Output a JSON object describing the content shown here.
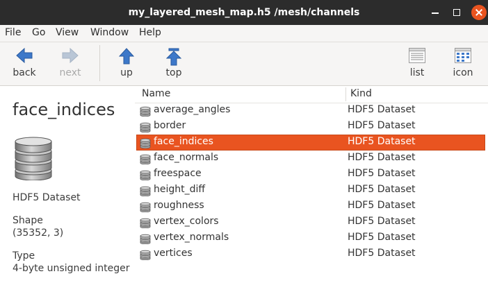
{
  "window": {
    "title": "my_layered_mesh_map.h5 /mesh/channels"
  },
  "menu": {
    "items": [
      "File",
      "Go",
      "View",
      "Window",
      "Help"
    ]
  },
  "toolbar": {
    "back_label": "back",
    "next_label": "next",
    "up_label": "up",
    "top_label": "top",
    "list_label": "list",
    "icon_label": "icon"
  },
  "info": {
    "name": "face_indices",
    "kind": "HDF5 Dataset",
    "shape_label": "Shape",
    "shape_value": "(35352, 3)",
    "type_label": "Type",
    "type_value": "4-byte unsigned integer"
  },
  "list": {
    "columns": {
      "name": "Name",
      "kind": "Kind"
    },
    "rows": [
      {
        "name": "average_angles",
        "kind": "HDF5 Dataset",
        "selected": false
      },
      {
        "name": "border",
        "kind": "HDF5 Dataset",
        "selected": false
      },
      {
        "name": "face_indices",
        "kind": "HDF5 Dataset",
        "selected": true
      },
      {
        "name": "face_normals",
        "kind": "HDF5 Dataset",
        "selected": false
      },
      {
        "name": "freespace",
        "kind": "HDF5 Dataset",
        "selected": false
      },
      {
        "name": "height_diff",
        "kind": "HDF5 Dataset",
        "selected": false
      },
      {
        "name": "roughness",
        "kind": "HDF5 Dataset",
        "selected": false
      },
      {
        "name": "vertex_colors",
        "kind": "HDF5 Dataset",
        "selected": false
      },
      {
        "name": "vertex_normals",
        "kind": "HDF5 Dataset",
        "selected": false
      },
      {
        "name": "vertices",
        "kind": "HDF5 Dataset",
        "selected": false
      }
    ],
    "row_icon": "database-icon"
  },
  "colors": {
    "titlebar": "#2c2c2c",
    "selection": "#e95420",
    "close_button": "#e95420",
    "arrow_blue": "#3d78c9",
    "disabled": "#a9a9a9"
  }
}
